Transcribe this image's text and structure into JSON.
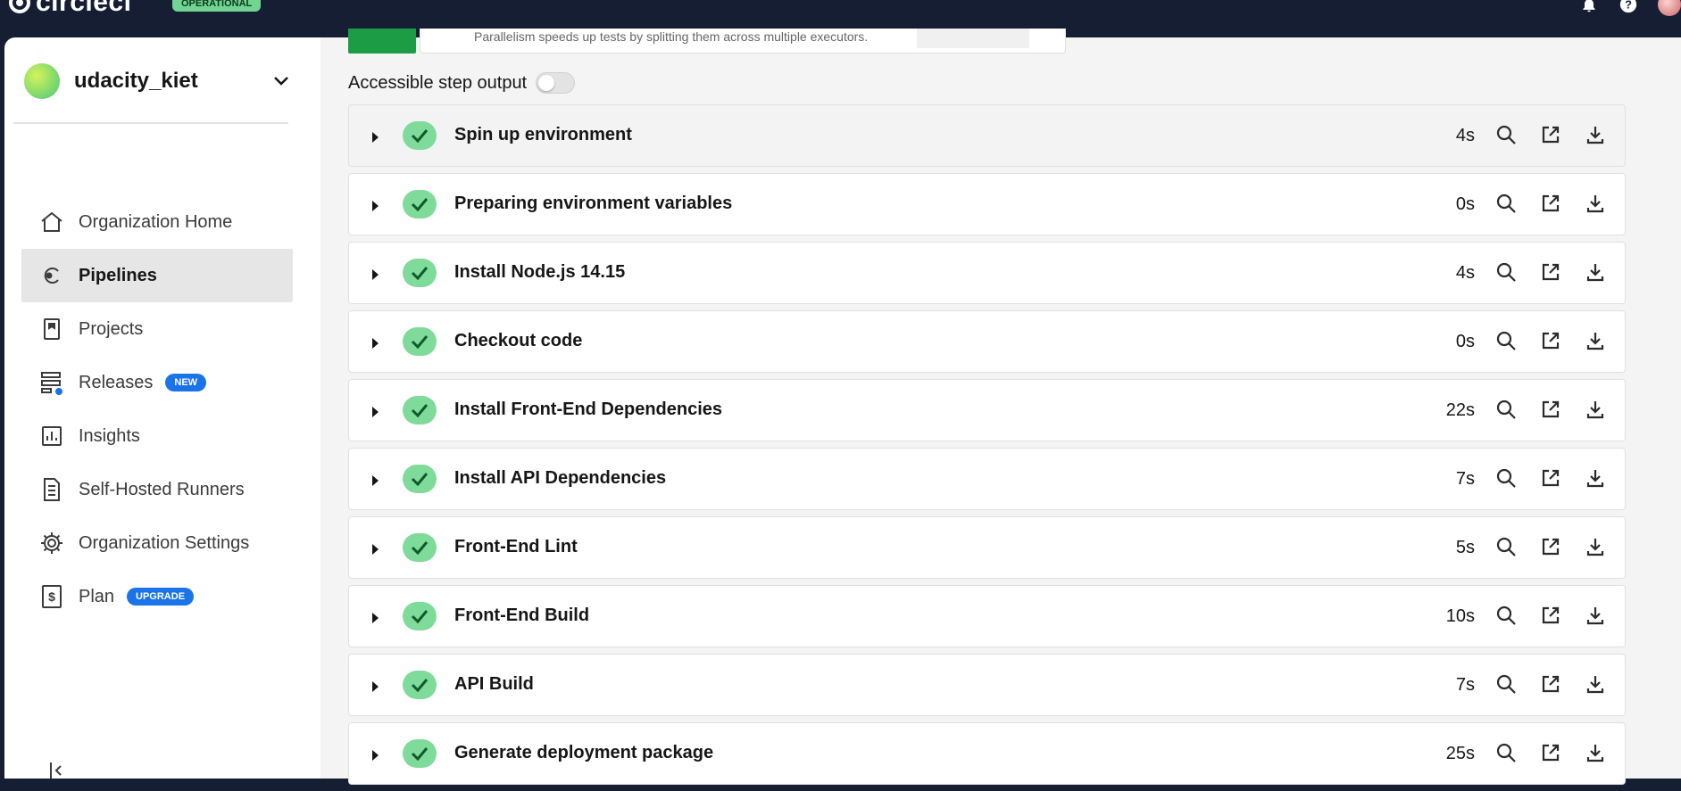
{
  "topbar": {
    "logo_text": "circleci",
    "status_badge": "OPERATIONAL"
  },
  "sidebar": {
    "org_name": "udacity_kiet",
    "items": [
      {
        "label": "Organization Home",
        "icon": "home-icon",
        "active": false
      },
      {
        "label": "Pipelines",
        "icon": "pipelines-icon",
        "active": true
      },
      {
        "label": "Projects",
        "icon": "projects-icon",
        "active": false
      },
      {
        "label": "Releases",
        "icon": "releases-icon",
        "active": false,
        "badge": "NEW"
      },
      {
        "label": "Insights",
        "icon": "insights-icon",
        "active": false
      },
      {
        "label": "Self-Hosted Runners",
        "icon": "runners-icon",
        "active": false
      },
      {
        "label": "Organization Settings",
        "icon": "gear-icon",
        "active": false
      },
      {
        "label": "Plan",
        "icon": "dollar-icon",
        "active": false,
        "badge": "UPGRADE"
      }
    ]
  },
  "main": {
    "stub_text": "Parallelism speeds up tests by splitting them across multiple executors.",
    "accessible_label": "Accessible step output",
    "steps": [
      {
        "name": "Spin up environment",
        "duration": "4s"
      },
      {
        "name": "Preparing environment variables",
        "duration": "0s"
      },
      {
        "name": "Install Node.js 14.15",
        "duration": "4s"
      },
      {
        "name": "Checkout code",
        "duration": "0s"
      },
      {
        "name": "Install Front-End Dependencies",
        "duration": "22s"
      },
      {
        "name": "Install API Dependencies",
        "duration": "7s"
      },
      {
        "name": "Front-End Lint",
        "duration": "5s"
      },
      {
        "name": "Front-End Build",
        "duration": "10s"
      },
      {
        "name": "API Build",
        "duration": "7s"
      },
      {
        "name": "Generate deployment package",
        "duration": "25s"
      }
    ]
  },
  "colors": {
    "topbar_bg": "#161e33",
    "success_green": "#7fdb9a",
    "badge_blue": "#1a73e8"
  }
}
